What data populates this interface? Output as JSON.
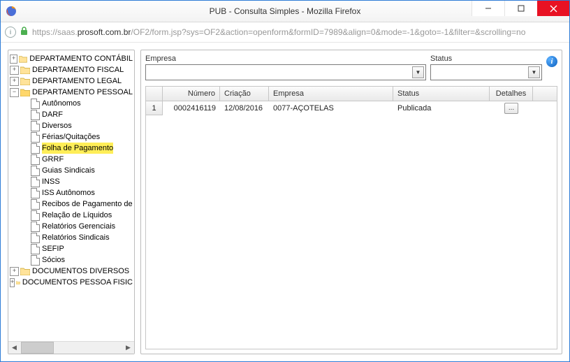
{
  "window": {
    "title": "PUB - Consulta Simples - Mozilla Firefox",
    "btn_min": "—",
    "btn_max": "▢",
    "btn_close": "✕"
  },
  "url": {
    "prefix": "https://saas.",
    "domain": "prosoft.com.br",
    "suffix": "/OF2/form.jsp?sys=OF2&action=openform&formID=7989&align=0&mode=-1&goto=-1&filter=&scrolling=no"
  },
  "sidebar": {
    "expand": "+",
    "collapse": "−",
    "nodes": [
      {
        "label": "DEPARTAMENTO CONTÁBIL",
        "exp": false
      },
      {
        "label": "DEPARTAMENTO FISCAL",
        "exp": false
      },
      {
        "label": "DEPARTAMENTO LEGAL",
        "exp": false
      },
      {
        "label": "DEPARTAMENTO PESSOAL",
        "exp": true,
        "children": [
          "Autônomos",
          "DARF",
          "Diversos",
          "Férias/Quitações",
          "Folha de Pagamento",
          "GRRF",
          "Guias Sindicais",
          "INSS",
          "ISS Autônomos",
          "Recibos de Pagamento de",
          "Relação de Líquidos",
          "Relatórios Gerenciais",
          "Relatórios Sindicais",
          "SEFIP",
          "Sócios"
        ]
      },
      {
        "label": "DOCUMENTOS DIVERSOS",
        "exp": false
      },
      {
        "label": "DOCUMENTOS PESSOA FISIC",
        "exp": false
      }
    ],
    "highlight_index": 4
  },
  "filters": {
    "empresa_label": "Empresa",
    "status_label": "Status",
    "empresa_value": "",
    "status_value": "",
    "info_char": "i"
  },
  "grid": {
    "headers": {
      "rownum": "",
      "numero": "Número",
      "criacao": "Criação",
      "empresa": "Empresa",
      "status": "Status",
      "detalhes": "Detalhes"
    },
    "rows": [
      {
        "n": "1",
        "numero": "0002416119",
        "criacao": "12/08/2016",
        "empresa": "0077-AÇOTELAS",
        "status": "Publicada",
        "detalhes": "..."
      }
    ]
  },
  "colors": {
    "accent": "#2e7cd6",
    "close": "#e81123",
    "highlight": "#ffee58"
  }
}
